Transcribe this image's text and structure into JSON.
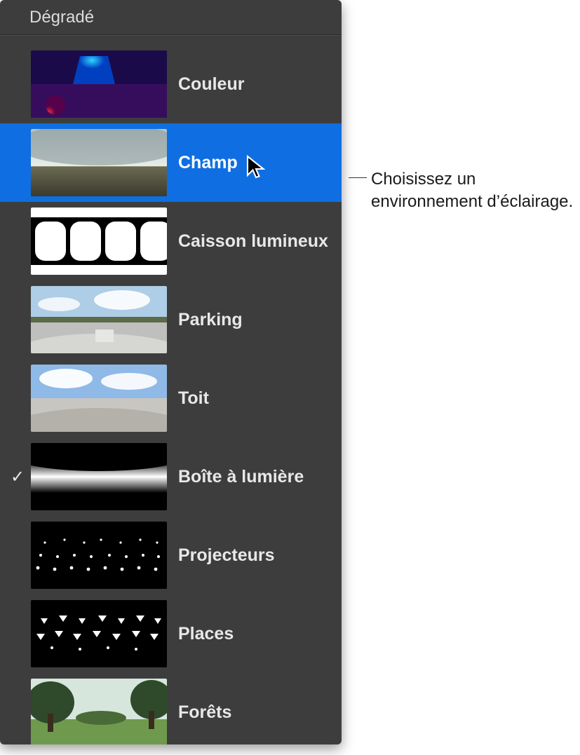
{
  "panel": {
    "title": "Dégradé",
    "items": [
      {
        "label": "Couleur",
        "selected": false,
        "checked": false,
        "thumb": "couleur"
      },
      {
        "label": "Champ",
        "selected": true,
        "checked": false,
        "thumb": "champ"
      },
      {
        "label": "Caisson lumineux",
        "selected": false,
        "checked": false,
        "thumb": "caisson"
      },
      {
        "label": "Parking",
        "selected": false,
        "checked": false,
        "thumb": "parking"
      },
      {
        "label": "Toit",
        "selected": false,
        "checked": false,
        "thumb": "toit"
      },
      {
        "label": "Boîte à lumière",
        "selected": false,
        "checked": true,
        "thumb": "softbox"
      },
      {
        "label": "Projecteurs",
        "selected": false,
        "checked": false,
        "thumb": "projecteurs"
      },
      {
        "label": "Places",
        "selected": false,
        "checked": false,
        "thumb": "places"
      },
      {
        "label": "Forêts",
        "selected": false,
        "checked": false,
        "thumb": "forets"
      }
    ]
  },
  "callout": {
    "text": "Choisissez un environnement d’éclairage."
  },
  "colors": {
    "panel_bg": "#3d3d3d",
    "highlight": "#0f6fe2",
    "text": "#e8e8e8"
  }
}
